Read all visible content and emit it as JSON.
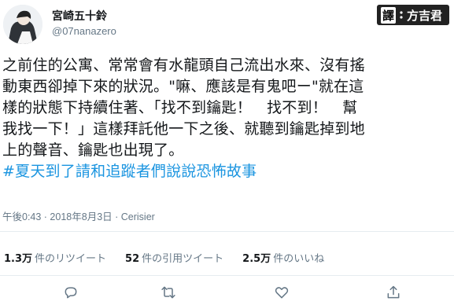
{
  "user": {
    "display_name": "宮崎五十鈴",
    "handle": "@07nanazero"
  },
  "badge": {
    "part1": "譯",
    "part2": "方吉君"
  },
  "tweet": {
    "lines": [
      "之前住的公寓、常常會有水龍頭自己流出水來、沒有搖",
      "動東西卻掉下來的狀況。\"嘛、應該是有鬼吧ー\"就在這",
      "樣的狀態下持續住著、「找不到鑰匙！　找不到！　幫",
      "我找一下！」這樣拜託他一下之後、就聽到鑰匙掉到地",
      "上的聲音、鑰匙也出現了。"
    ],
    "hashtag": "#夏天到了請和追蹤者們說說恐怖故事"
  },
  "meta": {
    "timestamp": "午後0:43 · 2018年8月3日 · Cerisier"
  },
  "stats": {
    "retweets_count": "1.3万",
    "retweets_label": "件のリツイート",
    "quotes_count": "52",
    "quotes_label": "件の引用ツイート",
    "likes_count": "2.5万",
    "likes_label": "件のいいね"
  },
  "icons": {
    "reply": "reply-icon",
    "retweet": "retweet-icon",
    "like": "heart-icon",
    "share": "share-icon"
  }
}
